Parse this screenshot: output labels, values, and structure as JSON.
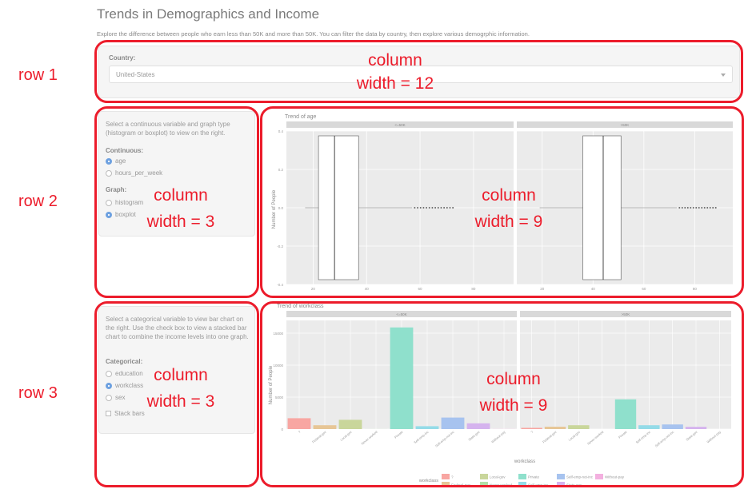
{
  "header": {
    "title": "Trends in Demographics and Income",
    "subtitle": "Explore the difference between people who earn less than 50K and more than 50K. You can filter the data by country, then explore various demogrphic information."
  },
  "country": {
    "label": "Country:",
    "selected": "United-States"
  },
  "continuous_panel": {
    "description": "Select a continuous variable and graph type (histogram or boxplot) to view on the right.",
    "continuous_label": "Continuous:",
    "continuous_options": [
      "age",
      "hours_per_week"
    ],
    "continuous_selected": "age",
    "graph_label": "Graph:",
    "graph_options": [
      "histogram",
      "boxplot"
    ],
    "graph_selected": "boxplot"
  },
  "categorical_panel": {
    "description": "Select a categorical variable to view bar chart on the right. Use the check box to view a stacked bar chart to combine the income levels into one graph.",
    "categorical_label": "Categorical:",
    "categorical_options": [
      "education",
      "workclass",
      "sex"
    ],
    "categorical_selected": "workclass",
    "stack_label": "Stack bars",
    "stack_checked": false
  },
  "annotations": {
    "row1": "row 1",
    "row2": "row 2",
    "row3": "row 3",
    "col_word": "column",
    "width12": "width = 12",
    "width3a": "width = 3",
    "width9a": "width = 9",
    "width3b": "width = 3",
    "width9b": "width = 9",
    "outline_color": "#ec1c2b"
  },
  "chart_data": [
    {
      "type": "boxplot",
      "title": "Trend of age",
      "ylabel": "Number of People",
      "facets": [
        "<=50K",
        ">50K"
      ],
      "yticks": [
        "0.4",
        "0.2",
        "0.0",
        "-0.2",
        "-0.4"
      ],
      "ylim": [
        -0.4,
        0.4
      ],
      "xticks": [
        "20",
        "40",
        "60",
        "80"
      ],
      "boxes": [
        {
          "facet": "<=50K",
          "q1": 22,
          "median": 28,
          "q3": 37,
          "whisker_low": 17,
          "whisker_high": 57
        },
        {
          "facet": ">50K",
          "q1": 36,
          "median": 44,
          "q3": 51,
          "whisker_low": 19,
          "whisker_high": 73
        }
      ],
      "box_color": "#ffffff",
      "panel_bg": "#ebebeb"
    },
    {
      "type": "bar",
      "title": "Trend of workclass",
      "ylabel": "Number of People",
      "xlabel": "workclass",
      "facets": [
        "<=50K",
        ">50K"
      ],
      "yticks": [
        "15000",
        "10000",
        "5000",
        "0"
      ],
      "ylim": [
        0,
        17000
      ],
      "categories": [
        "?",
        "Federal-gov",
        "Local-gov",
        "Never-worked",
        "Private",
        "Self-emp-inc",
        "Self-emp-not-inc",
        "State-gov",
        "Without-pay"
      ],
      "series": [
        {
          "name": "<=50K",
          "values": [
            1700,
            600,
            1450,
            7,
            15900,
            450,
            1800,
            900,
            14
          ]
        },
        {
          "name": ">50K",
          "values": [
            190,
            370,
            600,
            0,
            4650,
            600,
            720,
            350,
            0
          ]
        }
      ],
      "colors": [
        "#f8a6a2",
        "#e7c696",
        "#c9d69b",
        "#b2dfa7",
        "#8fe0cc",
        "#94dbe8",
        "#a7c3ef",
        "#d5b3ee",
        "#f3b0df"
      ],
      "legend_title": "workclass",
      "legend_position": "bottom",
      "panel_bg": "#ebebeb"
    }
  ]
}
